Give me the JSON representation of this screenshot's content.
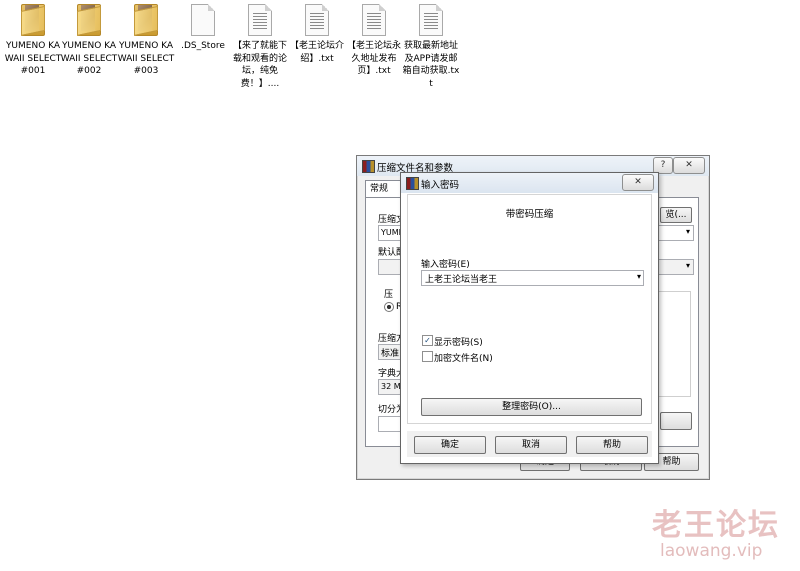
{
  "desktop": {
    "icons": [
      {
        "label": "YUMENO KAWAII SELECT #001",
        "type": "folder"
      },
      {
        "label": "YUMENO KAWAII SELECT #002",
        "type": "folder"
      },
      {
        "label": "YUMENO KAWAII SELECT #003",
        "type": "folder"
      },
      {
        "label": ".DS_Store",
        "type": "file"
      },
      {
        "label": "【来了就能下载和观看的论坛，纯免费！】....",
        "type": "text-file"
      },
      {
        "label": "【老王论坛介绍】.txt",
        "type": "text-file"
      },
      {
        "label": "【老王论坛永久地址发布页】.txt",
        "type": "text-file"
      },
      {
        "label": "获取最新地址及APP请发邮箱自动获取.txt",
        "type": "text-file"
      }
    ]
  },
  "archive_dialog": {
    "title": "压缩文件名和参数",
    "help_caption": "?",
    "close_caption": "✕",
    "tab_general": "常规",
    "archive_name_label": "压缩文",
    "archive_name_value": "YUME",
    "browse_button": "览(...",
    "default_profile_label": "默认配",
    "update_mode_label": "压",
    "radio_label": "R",
    "compression_label": "压缩方",
    "compression_value": "标准",
    "dictionary_label": "字典大",
    "dictionary_value": "32 MB",
    "split_label": "切分为",
    "ok_button": "确定",
    "cancel_button": "取消",
    "help_button": "帮助"
  },
  "password_dialog": {
    "title": "输入密码",
    "close_caption": "✕",
    "heading": "带密码压缩",
    "password_label": "输入密码(E)",
    "password_value": "上老王论坛当老王",
    "show_password_label": "显示密码(S)",
    "show_password_checked": true,
    "encrypt_names_label": "加密文件名(N)",
    "encrypt_names_checked": false,
    "organize_button": "整理密码(O)...",
    "ok_button": "确定",
    "cancel_button": "取消",
    "help_button": "帮助"
  },
  "watermark": {
    "title": "老王论坛",
    "url": "laowang.vip"
  }
}
